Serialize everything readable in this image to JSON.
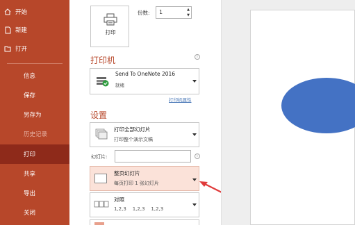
{
  "sidebar": {
    "items": [
      {
        "label": "开始",
        "icon": "home-icon"
      },
      {
        "label": "新建",
        "icon": "new-document-icon"
      },
      {
        "label": "打开",
        "icon": "folder-open-icon"
      },
      {
        "label": "信息"
      },
      {
        "label": "保存"
      },
      {
        "label": "另存为"
      },
      {
        "label": "历史记录"
      },
      {
        "label": "打印"
      },
      {
        "label": "共享"
      },
      {
        "label": "导出"
      },
      {
        "label": "关闭"
      }
    ]
  },
  "print": {
    "button_label": "打印",
    "copies_label": "份数:",
    "copies_value": "1"
  },
  "printer": {
    "section_title": "打印机",
    "name": "Send To OneNote 2016",
    "status": "就绪",
    "properties_link": "打印机属性"
  },
  "settings": {
    "section_title": "设置",
    "range": {
      "title": "打印全部幻灯片",
      "subtitle": "打印整个演示文稿"
    },
    "slides_label": "幻灯片:",
    "slides_value": "",
    "layout": {
      "title": "整页幻灯片",
      "subtitle": "每页打印 1 张幻灯片"
    },
    "collate": {
      "title": "对照",
      "subtitle": "1,2,3    1,2,3    1,2,3"
    }
  },
  "colors": {
    "accent": "#b7472a",
    "active": "#8e2a1a",
    "highlight": "#fbe2d9",
    "shape": "#4472c4",
    "arrow": "#e03b3b"
  }
}
